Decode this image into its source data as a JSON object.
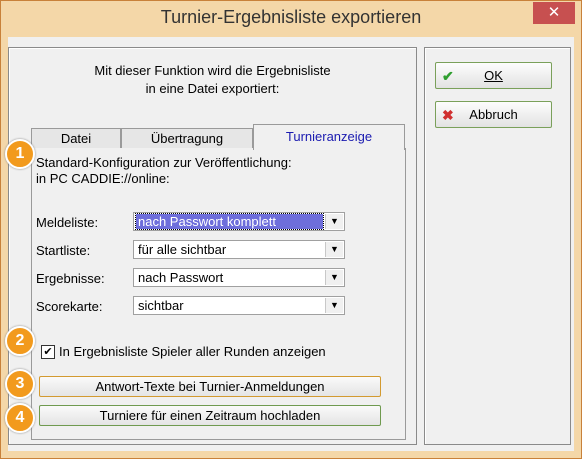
{
  "window": {
    "title": "Turnier-Ergebnisliste exportieren",
    "close_glyph": "✕"
  },
  "intro": {
    "line1": "Mit dieser Funktion wird die Ergebnisliste",
    "line2": "in eine Datei exportiert:"
  },
  "tabs": [
    {
      "label": "Datei"
    },
    {
      "label": "Übertragung"
    },
    {
      "label": "Turnieranzeige",
      "active": true
    }
  ],
  "description": {
    "line1": "Standard-Konfiguration zur Veröffentlichung:",
    "line2": "in PC CADDIE://online:"
  },
  "fields": [
    {
      "label": "Meldeliste:",
      "value": "nach Passwort komplett",
      "focused": true
    },
    {
      "label": "Startliste:",
      "value": "für alle sichtbar"
    },
    {
      "label": "Ergebnisse:",
      "value": "nach Passwort"
    },
    {
      "label": "Scorekarte:",
      "value": "sichtbar"
    }
  ],
  "checkbox": {
    "label": "In Ergebnisliste Spieler aller Runden anzeigen",
    "checked": true,
    "mark": "✔"
  },
  "buttons": {
    "antwort": "Antwort-Texte bei Turnier-Anmeldungen",
    "zeitraum": "Turniere für einen Zeitraum hochladen",
    "ok": "OK",
    "cancel": "Abbruch"
  },
  "icons": {
    "ok": "check-icon",
    "cancel": "cross-icon",
    "dropdown": "dropdown-arrow-icon"
  },
  "badges": [
    "1",
    "2",
    "3",
    "4"
  ],
  "colors": {
    "accent_orange": "#f29a1d",
    "active_tab_text": "#1a1ab0",
    "selection": "#6e6edb"
  }
}
